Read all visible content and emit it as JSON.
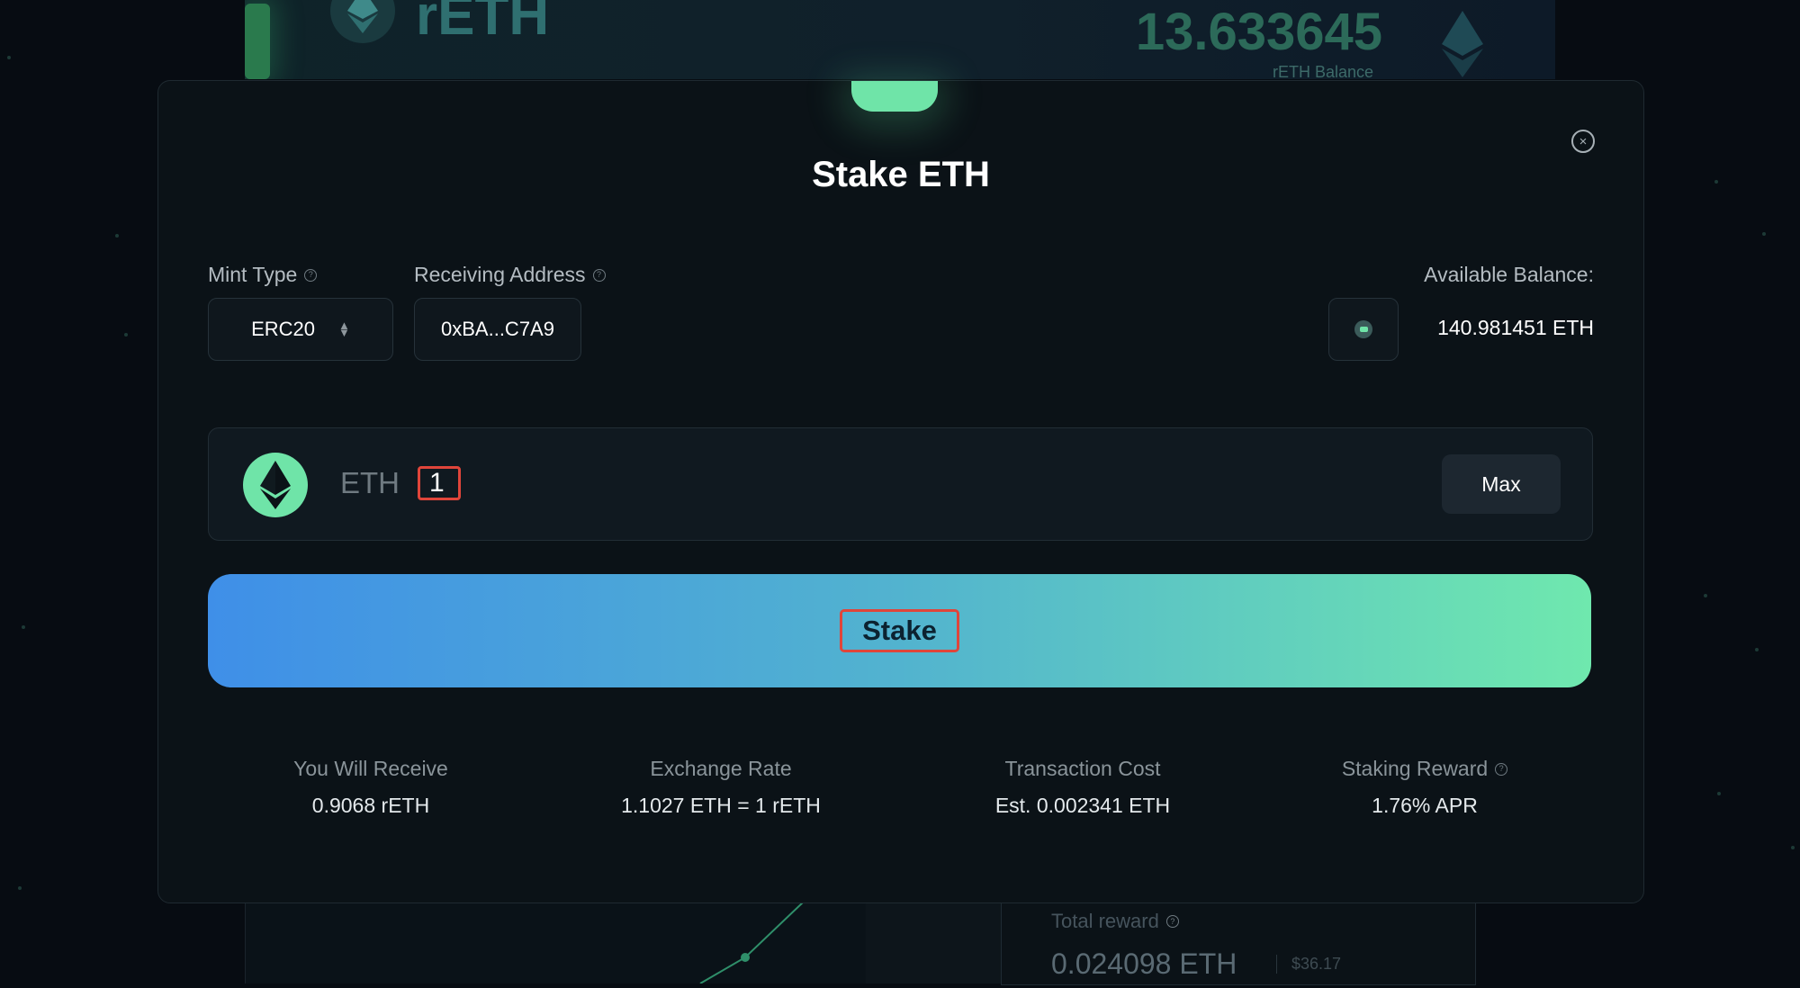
{
  "background": {
    "header": {
      "ticker": "rETH",
      "balance_value": "13.633645",
      "balance_label": "rETH Balance"
    },
    "total_reward": {
      "label": "Total reward",
      "value": "0.024098 ETH",
      "usd": "$36.17"
    }
  },
  "modal": {
    "title": "Stake ETH",
    "mint_type": {
      "label": "Mint Type",
      "value": "ERC20"
    },
    "receiving_address": {
      "label": "Receiving Address",
      "value": "0xBA...C7A9"
    },
    "available_balance": {
      "label": "Available Balance:",
      "value": "140.981451 ETH"
    },
    "amount": {
      "token": "ETH",
      "value": "1",
      "max_label": "Max"
    },
    "stake_button": "Stake",
    "stats": [
      {
        "label": "You Will Receive",
        "value": "0.9068 rETH"
      },
      {
        "label": "Exchange Rate",
        "value": "1.1027 ETH = 1 rETH"
      },
      {
        "label": "Transaction Cost",
        "value": "Est. 0.002341 ETH"
      },
      {
        "label": "Staking Reward",
        "value": "1.76% APR"
      }
    ]
  },
  "colors": {
    "accent_green": "#6fe4a8",
    "accent_blue": "#3f8fe8",
    "highlight_red": "#e0453a",
    "modal_bg": "#0b1217"
  },
  "icons": [
    "eth-icon",
    "close-icon",
    "help-icon",
    "updown-icon",
    "wallet-icon"
  ]
}
